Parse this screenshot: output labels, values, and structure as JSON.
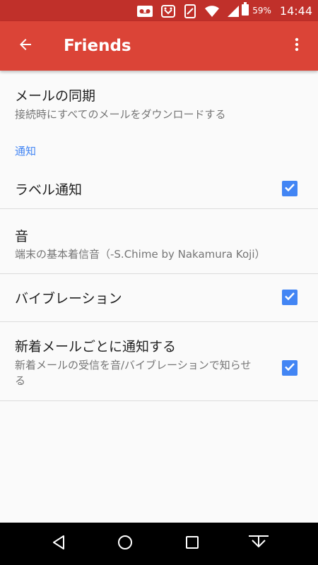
{
  "status_bar": {
    "battery_percent": "59%",
    "time": "14:44"
  },
  "app_bar": {
    "title": "Friends"
  },
  "settings": {
    "sync": {
      "title": "メールの同期",
      "summary": "接続時にすべてのメールをダウンロードする"
    },
    "category_label": "通知",
    "label_notification": {
      "title": "ラベル通知",
      "checked": true
    },
    "sound": {
      "title": "音",
      "summary": "端末の基本着信音（-S.Chime by Nakamura Koji）"
    },
    "vibration": {
      "title": "バイブレーション",
      "checked": true
    },
    "notify_each": {
      "title": "新着メールごとに通知する",
      "summary": "新着メールの受信を音/バイブレーションで知らせる",
      "checked": true
    }
  },
  "colors": {
    "status_bar": "#c0302a",
    "app_bar": "#db4437",
    "accent": "#4285f4",
    "background": "#fafafa"
  }
}
